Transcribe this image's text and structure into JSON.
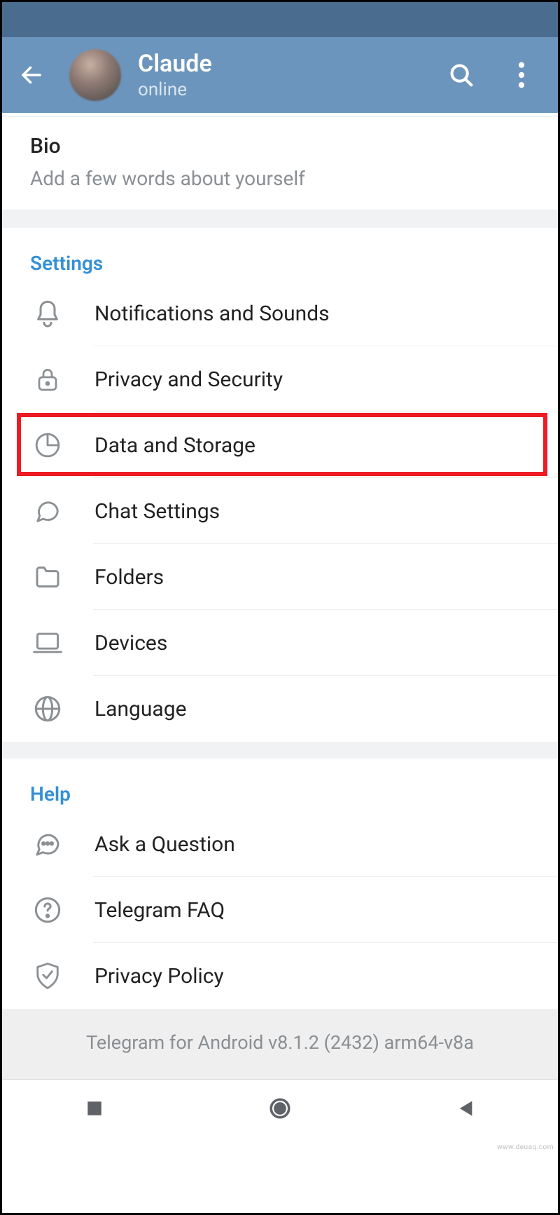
{
  "header": {
    "name": "Claude",
    "status": "online"
  },
  "bio": {
    "title": "Bio",
    "subtitle": "Add a few words about yourself"
  },
  "settings": {
    "header": "Settings",
    "items": [
      {
        "icon": "bell-icon",
        "label": "Notifications and Sounds"
      },
      {
        "icon": "lock-icon",
        "label": "Privacy and Security"
      },
      {
        "icon": "pie-icon",
        "label": "Data and Storage"
      },
      {
        "icon": "chat-icon",
        "label": "Chat Settings"
      },
      {
        "icon": "folder-icon",
        "label": "Folders"
      },
      {
        "icon": "laptop-icon",
        "label": "Devices"
      },
      {
        "icon": "globe-icon",
        "label": "Language"
      }
    ]
  },
  "help": {
    "header": "Help",
    "items": [
      {
        "icon": "ask-icon",
        "label": "Ask a Question"
      },
      {
        "icon": "faq-icon",
        "label": "Telegram FAQ"
      },
      {
        "icon": "shield-icon",
        "label": "Privacy Policy"
      }
    ]
  },
  "footer": {
    "version": "Telegram for Android v8.1.2 (2432) arm64-v8a"
  },
  "highlighted_index": 2,
  "watermark": "www.deuaq.com"
}
